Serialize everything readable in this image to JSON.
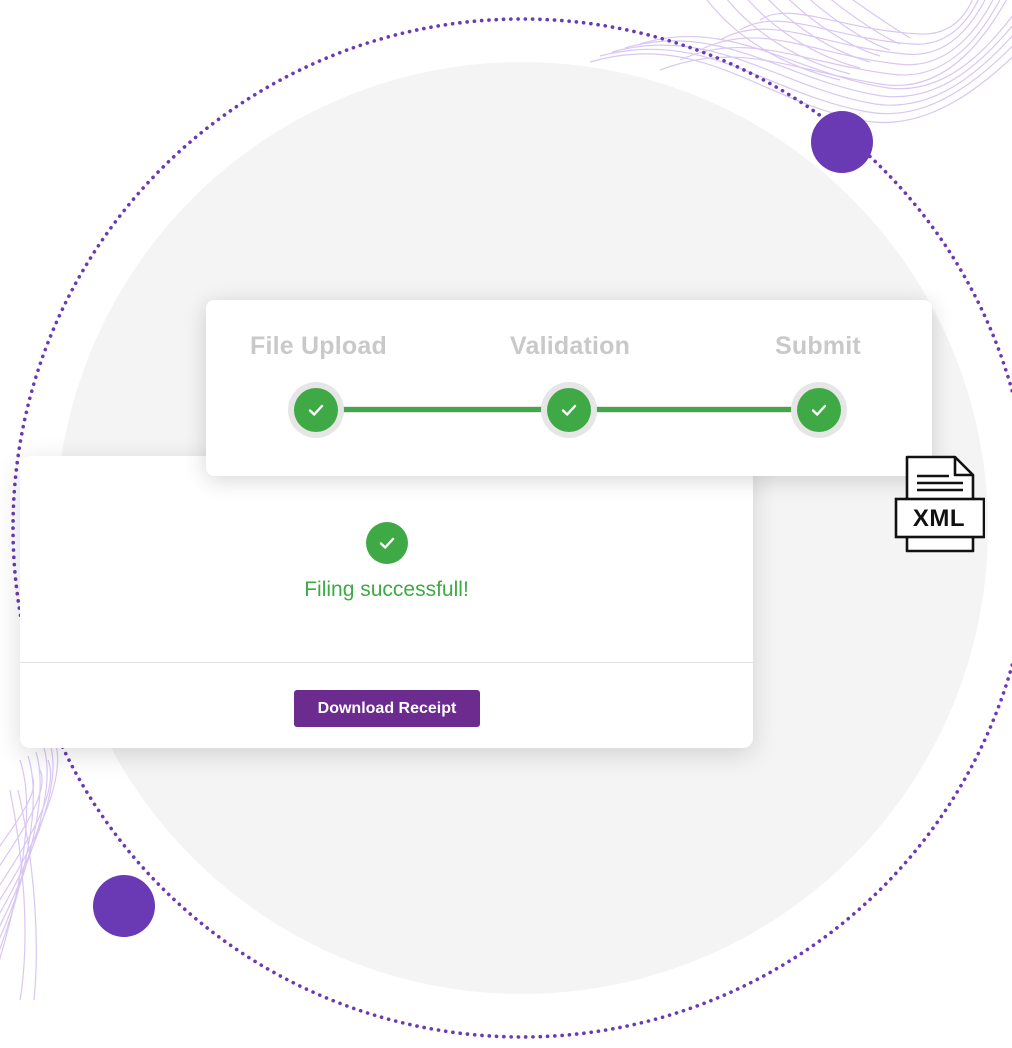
{
  "stepper": {
    "steps": [
      {
        "label": "File Upload",
        "status": "complete"
      },
      {
        "label": "Validation",
        "status": "complete"
      },
      {
        "label": "Submit",
        "status": "complete"
      }
    ],
    "progress_fraction": 1.0
  },
  "result": {
    "message": "Filing successfull!",
    "download_label": "Download Receipt"
  },
  "file_badge": {
    "text": "XML",
    "icon": "xml-file-icon"
  },
  "colors": {
    "accent_purple": "#6b2b8f",
    "decor_purple": "#6a3ab5",
    "success_green": "#3faa45",
    "step_label_gray": "#c9c9c9",
    "backdrop_gray": "#f4f4f4"
  }
}
